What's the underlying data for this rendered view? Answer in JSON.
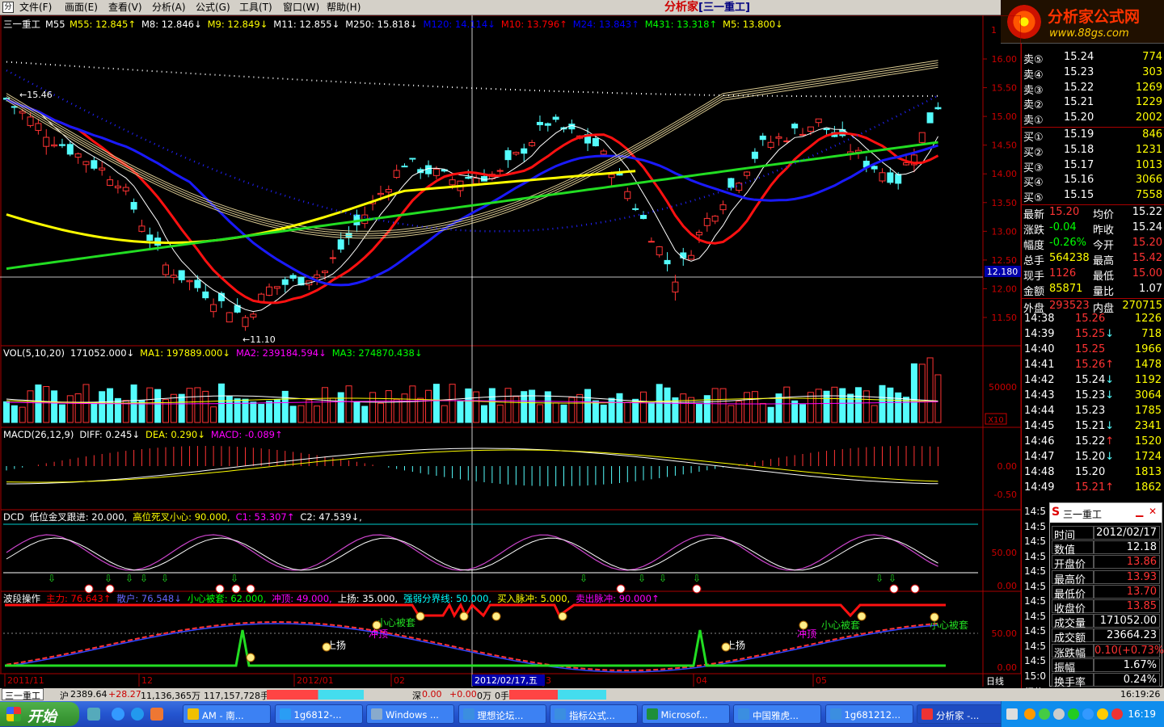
{
  "menu": {
    "items": [
      "文件(F)",
      "画面(E)",
      "查看(V)",
      "分析(A)",
      "公式(G)",
      "工具(T)",
      "窗口(W)",
      "帮助(H)"
    ],
    "brand": "分析家",
    "brand_sub": "[三一重工]"
  },
  "logo": {
    "line1": "分析家公式网",
    "line2": "www.88gs.com"
  },
  "main_title": {
    "name": "三一重工",
    "period": "M55",
    "items": [
      {
        "t": "M55: 12.845↑",
        "c": "#ffff00"
      },
      {
        "t": "M8: 12.846↓",
        "c": "#ffffff"
      },
      {
        "t": "M9: 12.849↓",
        "c": "#ffff00"
      },
      {
        "t": "M11: 12.855↓",
        "c": "#ffffff"
      },
      {
        "t": "M250: 15.818↓",
        "c": "#ffffff"
      },
      {
        "t": "M120: 14.114↓",
        "c": "#0000ff"
      },
      {
        "t": "M10: 13.796↑",
        "c": "#ff0000"
      },
      {
        "t": "M24: 13.843↑",
        "c": "#0000ff"
      },
      {
        "t": "M431: 13.318↑",
        "c": "#00ff00"
      },
      {
        "t": "M5: 13.800↓",
        "c": "#ffff00"
      }
    ]
  },
  "price_axis": {
    "labels": [
      "16.00",
      "15.50",
      "15.00",
      "14.50",
      "14.00",
      "13.50",
      "13.00",
      "12.50",
      "12.00",
      "11.50"
    ],
    "current": "12.180",
    "high_mark": "15.46",
    "low_mark": "11.10"
  },
  "vol_title": {
    "items": [
      {
        "t": "VOL(5,10,20)",
        "c": "#ffffff"
      },
      {
        "t": "171052.000↓",
        "c": "#ffffff"
      },
      {
        "t": "MA1: 197889.000↓",
        "c": "#ffff00"
      },
      {
        "t": "MA2: 239184.594↓",
        "c": "#ff00ff"
      },
      {
        "t": "MA3: 274870.438↓",
        "c": "#00ff00"
      }
    ]
  },
  "vol_axis": {
    "labels": [
      "50000"
    ],
    "unit": "X10"
  },
  "macd_title": {
    "items": [
      {
        "t": "MACD(26,12,9)",
        "c": "#ffffff"
      },
      {
        "t": "DIFF: 0.245↓",
        "c": "#ffffff"
      },
      {
        "t": "DEA: 0.290↓",
        "c": "#ffff00"
      },
      {
        "t": "MACD: -0.089↑",
        "c": "#ff00ff"
      }
    ]
  },
  "macd_axis": {
    "labels": [
      "0.00",
      "-0.50"
    ]
  },
  "dcd_title": {
    "items": [
      {
        "t": "DCD",
        "c": "#ffffff"
      },
      {
        "t": "低位金叉跟进: 20.000,",
        "c": "#ffffff"
      },
      {
        "t": "高位死叉小心: 90.000,",
        "c": "#ffff00"
      },
      {
        "t": "C1: 53.307↑",
        "c": "#ff00ff"
      },
      {
        "t": "C2: 47.539↓,",
        "c": "#ffffff"
      }
    ]
  },
  "dcd_axis": {
    "labels": [
      "50.00",
      "0.00"
    ]
  },
  "wave_title": {
    "items": [
      {
        "t": "波段操作",
        "c": "#ffffff"
      },
      {
        "t": "主力: 76.643↑",
        "c": "#ff0000"
      },
      {
        "t": "散户: 76.548↓",
        "c": "#6666ff"
      },
      {
        "t": "小心被套: 62.000,",
        "c": "#00ff00"
      },
      {
        "t": "冲顶: 49.000,",
        "c": "#ff00ff"
      },
      {
        "t": "上扬: 35.000,",
        "c": "#ffffff"
      },
      {
        "t": "强弱分界线: 50.000,",
        "c": "#00ffff"
      },
      {
        "t": "买入脉冲: 5.000,",
        "c": "#ffff00"
      },
      {
        "t": "卖出脉冲: 90.000↑",
        "c": "#ff00ff"
      }
    ]
  },
  "wave_axis": {
    "labels": [
      "50.00",
      "0.00"
    ]
  },
  "wave_labels": [
    "小心被套",
    "冲顶",
    "上扬",
    "小心被套",
    "冲顶",
    "上扬",
    "小心被套"
  ],
  "date_axis": {
    "labels": [
      "2011/11",
      "12",
      "2012/01",
      "02",
      "3",
      "04",
      "05"
    ],
    "cursor": "2012/02/17,五",
    "right": "日线"
  },
  "quote": {
    "asks": [
      {
        "l": "卖⑤",
        "p": "15.24",
        "v": "774"
      },
      {
        "l": "卖④",
        "p": "15.23",
        "v": "303"
      },
      {
        "l": "卖③",
        "p": "15.22",
        "v": "1269"
      },
      {
        "l": "卖②",
        "p": "15.21",
        "v": "1229"
      },
      {
        "l": "卖①",
        "p": "15.20",
        "v": "2002"
      }
    ],
    "bids": [
      {
        "l": "买①",
        "p": "15.19",
        "v": "846"
      },
      {
        "l": "买②",
        "p": "15.18",
        "v": "1231"
      },
      {
        "l": "买③",
        "p": "15.17",
        "v": "1013"
      },
      {
        "l": "买④",
        "p": "15.16",
        "v": "3066"
      },
      {
        "l": "买⑤",
        "p": "15.15",
        "v": "7558"
      }
    ],
    "stats": [
      {
        "l": "最新",
        "v": "15.20",
        "c": "#ff3333",
        "l2": "均价",
        "v2": "15.22",
        "c2": "#ffffff"
      },
      {
        "l": "涨跌",
        "v": "-0.04",
        "c": "#00ff00",
        "l2": "昨收",
        "v2": "15.24",
        "c2": "#ffffff"
      },
      {
        "l": "幅度",
        "v": "-0.26%",
        "c": "#00ff00",
        "l2": "今开",
        "v2": "15.20",
        "c2": "#ff3333"
      },
      {
        "l": "总手",
        "v": "564238",
        "c": "#ffff00",
        "l2": "最高",
        "v2": "15.42",
        "c2": "#ff3333"
      },
      {
        "l": "现手",
        "v": "1126",
        "c": "#ff3333",
        "l2": "最低",
        "v2": "15.00",
        "c2": "#ff3333"
      },
      {
        "l": "金额",
        "v": "85871",
        "c": "#ffff00",
        "l2": "量比",
        "v2": "1.07",
        "c2": "#ffffff"
      },
      {
        "l": "外盘",
        "v": "293523",
        "c": "#ff3333",
        "l2": "内盘",
        "v2": "270715",
        "c2": "#ffff00"
      }
    ]
  },
  "ticks": [
    {
      "t": "14:38",
      "p": "15.26",
      "a": "",
      "v": "1226",
      "c": "#ff3333"
    },
    {
      "t": "14:39",
      "p": "15.25",
      "a": "↓",
      "v": "718",
      "c": "#ff3333"
    },
    {
      "t": "14:40",
      "p": "15.25",
      "a": "",
      "v": "1966",
      "c": "#ff3333"
    },
    {
      "t": "14:41",
      "p": "15.26",
      "a": "↑",
      "v": "1478",
      "c": "#ff3333"
    },
    {
      "t": "14:42",
      "p": "15.24",
      "a": "↓",
      "v": "1192",
      "c": "#ffffff"
    },
    {
      "t": "14:43",
      "p": "15.23",
      "a": "↓",
      "v": "3064",
      "c": "#ffffff"
    },
    {
      "t": "14:44",
      "p": "15.23",
      "a": "",
      "v": "1785",
      "c": "#ffffff"
    },
    {
      "t": "14:45",
      "p": "15.21",
      "a": "↓",
      "v": "2341",
      "c": "#ffffff"
    },
    {
      "t": "14:46",
      "p": "15.22",
      "a": "↑",
      "v": "1520",
      "c": "#ffffff"
    },
    {
      "t": "14:47",
      "p": "15.20",
      "a": "↓",
      "v": "1724",
      "c": "#ffffff"
    },
    {
      "t": "14:48",
      "p": "15.20",
      "a": "",
      "v": "1813",
      "c": "#ffffff"
    },
    {
      "t": "14:49",
      "p": "15.21",
      "a": "↑",
      "v": "1862",
      "c": "#ff3333"
    }
  ],
  "side_times": [
    "14:5",
    "14:5",
    "14:5",
    "14:5",
    "14:5",
    "14:5",
    "14:5",
    "14:5",
    "14:5",
    "14:5",
    "14:5",
    "15:0",
    "细价"
  ],
  "popup": {
    "title": "三一重工",
    "rows": [
      {
        "l": "时间",
        "v": "2012/02/17",
        "c": "#ffffff"
      },
      {
        "l": "数值",
        "v": "12.18",
        "c": "#ffffff"
      },
      {
        "l": "开盘价",
        "v": "13.86",
        "c": "#ff3333"
      },
      {
        "l": "最高价",
        "v": "13.93",
        "c": "#ff3333"
      },
      {
        "l": "最低价",
        "v": "13.70",
        "c": "#ff3333"
      },
      {
        "l": "收盘价",
        "v": "13.85",
        "c": "#ff3333"
      },
      {
        "l": "成交量",
        "v": "171052.00",
        "c": "#ffffff"
      },
      {
        "l": "成交额",
        "v": "23664.23",
        "c": "#ffffff"
      },
      {
        "l": "涨跌幅",
        "v": "0.10(+0.73%)",
        "c": "#ff3333"
      },
      {
        "l": "振幅",
        "v": "1.67%",
        "c": "#ffffff"
      },
      {
        "l": "换手率",
        "v": "0.24%",
        "c": "#ffffff"
      }
    ]
  },
  "status": {
    "tab": "三一重工",
    "sh_label": "沪",
    "sh_index": "2389.64",
    "sh_change": "+28.27",
    "sh_vol": "11,136,365万",
    "sh_shares": "117,157,728手",
    "sz_label": "深",
    "sz_index": "0.00",
    "sz_change": "+0.00",
    "sz_vol": "0万",
    "sz_shares": "0手",
    "time": "16:19:26"
  },
  "taskbar": {
    "start": "开始",
    "buttons": [
      "AM - 南...",
      "1g6812-...",
      "Windows ...",
      "理想论坛...",
      "指标公式...",
      "Microsof...",
      "中国雅虎...",
      "1g681212...",
      "分析家 -..."
    ],
    "clock": "16:19"
  }
}
